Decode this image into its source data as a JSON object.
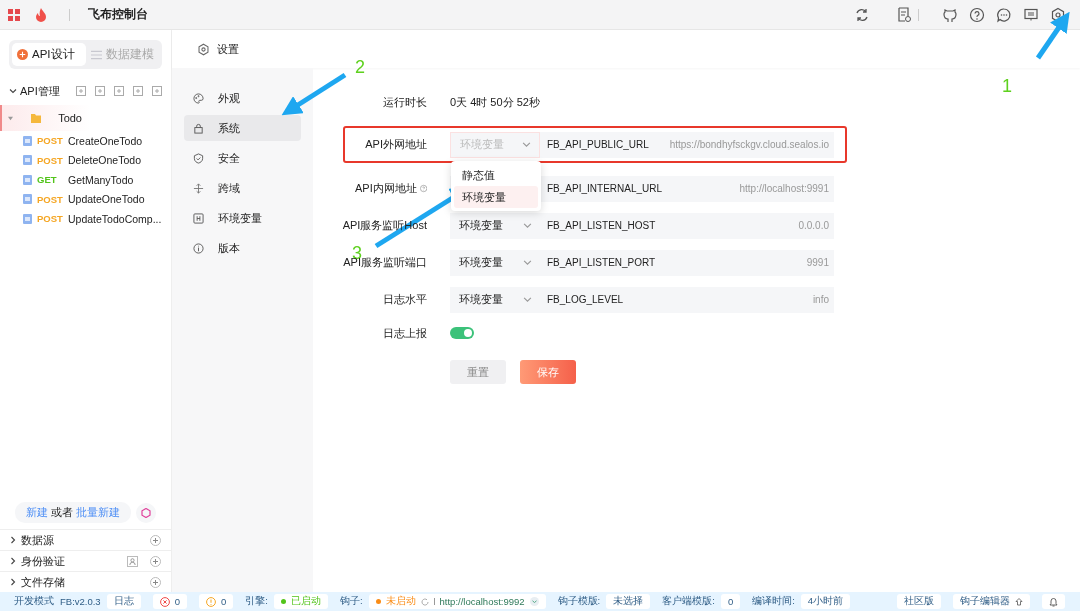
{
  "topbar": {
    "title": "飞布控制台"
  },
  "sidebar": {
    "tabs": [
      {
        "label": "API设计",
        "selected": true
      },
      {
        "label": "数据建模",
        "selected": false
      }
    ],
    "api_section": {
      "title": "API管理",
      "expanded": true
    },
    "tree": [
      {
        "name": "Todo",
        "expanded": true,
        "selected": true,
        "children": [
          {
            "method": "POST",
            "color": "#f5a623",
            "name": "CreateOneTodo"
          },
          {
            "method": "POST",
            "color": "#f5a623",
            "name": "DeleteOneTodo"
          },
          {
            "method": "GET",
            "color": "#52c41a",
            "name": "GetManyTodo"
          },
          {
            "method": "POST",
            "color": "#f5a623",
            "name": "UpdateOneTodo"
          },
          {
            "method": "POST",
            "color": "#f5a623",
            "name": "UpdateTodoComp..."
          }
        ]
      }
    ],
    "create": {
      "link": "新建",
      "or": "或者",
      "batch_link": "批量新建"
    },
    "sections": [
      {
        "title": "数据源",
        "expanded": false,
        "user_icon": false
      },
      {
        "title": "身份验证",
        "expanded": false,
        "user_icon": true
      },
      {
        "title": "文件存储",
        "expanded": false,
        "user_icon": false
      }
    ]
  },
  "page": {
    "title": "设置"
  },
  "settings_nav": [
    {
      "label": "外观",
      "kind": "palette",
      "selected": false
    },
    {
      "label": "系统",
      "kind": "lock",
      "selected": true
    },
    {
      "label": "安全",
      "kind": "shield",
      "selected": false
    },
    {
      "label": "跨域",
      "kind": "cross",
      "selected": false
    },
    {
      "label": "环境变量",
      "kind": "env",
      "selected": false
    },
    {
      "label": "版本",
      "kind": "info",
      "selected": false
    }
  ],
  "form": {
    "uptime": {
      "label": "运行时长",
      "value": "0天 4时 50分 52秒"
    },
    "rows": [
      {
        "label": "API外网地址",
        "help": false,
        "source": "环境变量",
        "open": true,
        "highlighted": true,
        "env": "FB_API_PUBLIC_URL",
        "value": "https://bondhyfsckgv.cloud.sealos.io"
      },
      {
        "label": "API内网地址",
        "help": true,
        "open": false,
        "highlighted": false,
        "env": "FB_API_INTERNAL_URL",
        "value": "http://localhost:9991"
      },
      {
        "label": "API服务监听Host",
        "help": false,
        "source": "环境变量",
        "open": false,
        "highlighted": false,
        "env": "FB_API_LISTEN_HOST",
        "value": "0.0.0.0"
      },
      {
        "label": "API服务监听端口",
        "help": false,
        "source": "环境变量",
        "open": false,
        "highlighted": false,
        "env": "FB_API_LISTEN_PORT",
        "value": "9991"
      },
      {
        "label": "日志水平",
        "help": false,
        "source": "环境变量",
        "open": false,
        "highlighted": false,
        "env": "FB_LOG_LEVEL",
        "value": "info"
      }
    ],
    "dropdown": [
      {
        "label": "静态值",
        "selected": false
      },
      {
        "label": "环境变量",
        "selected": true
      }
    ],
    "log_report": {
      "label": "日志上报",
      "on": true
    },
    "buttons": {
      "reset": "重置",
      "save": "保存"
    }
  },
  "status_bar": {
    "mode": "开发模式",
    "version": "FB:v2.0.3",
    "log": "日志",
    "errors": "0",
    "warnings": "0",
    "engine": {
      "label": "引擎:",
      "status": "已启动",
      "color": "#52c41a"
    },
    "hook": {
      "label": "钩子:",
      "status": "未启动",
      "color": "#fa8c16",
      "url": "http://localhost:9992"
    },
    "hook_tpl_label": "钩子模版:",
    "hook_tpl": "未选择",
    "client_tpl_label": "客户端模版:",
    "client_tpl": "0",
    "compile_label": "编译时间:",
    "compile_time": "4小时前",
    "edition": "社区版",
    "hook_editor": "钩子编辑器"
  },
  "annotations": [
    {
      "number": "1"
    },
    {
      "number": "2"
    },
    {
      "number": "3"
    }
  ]
}
